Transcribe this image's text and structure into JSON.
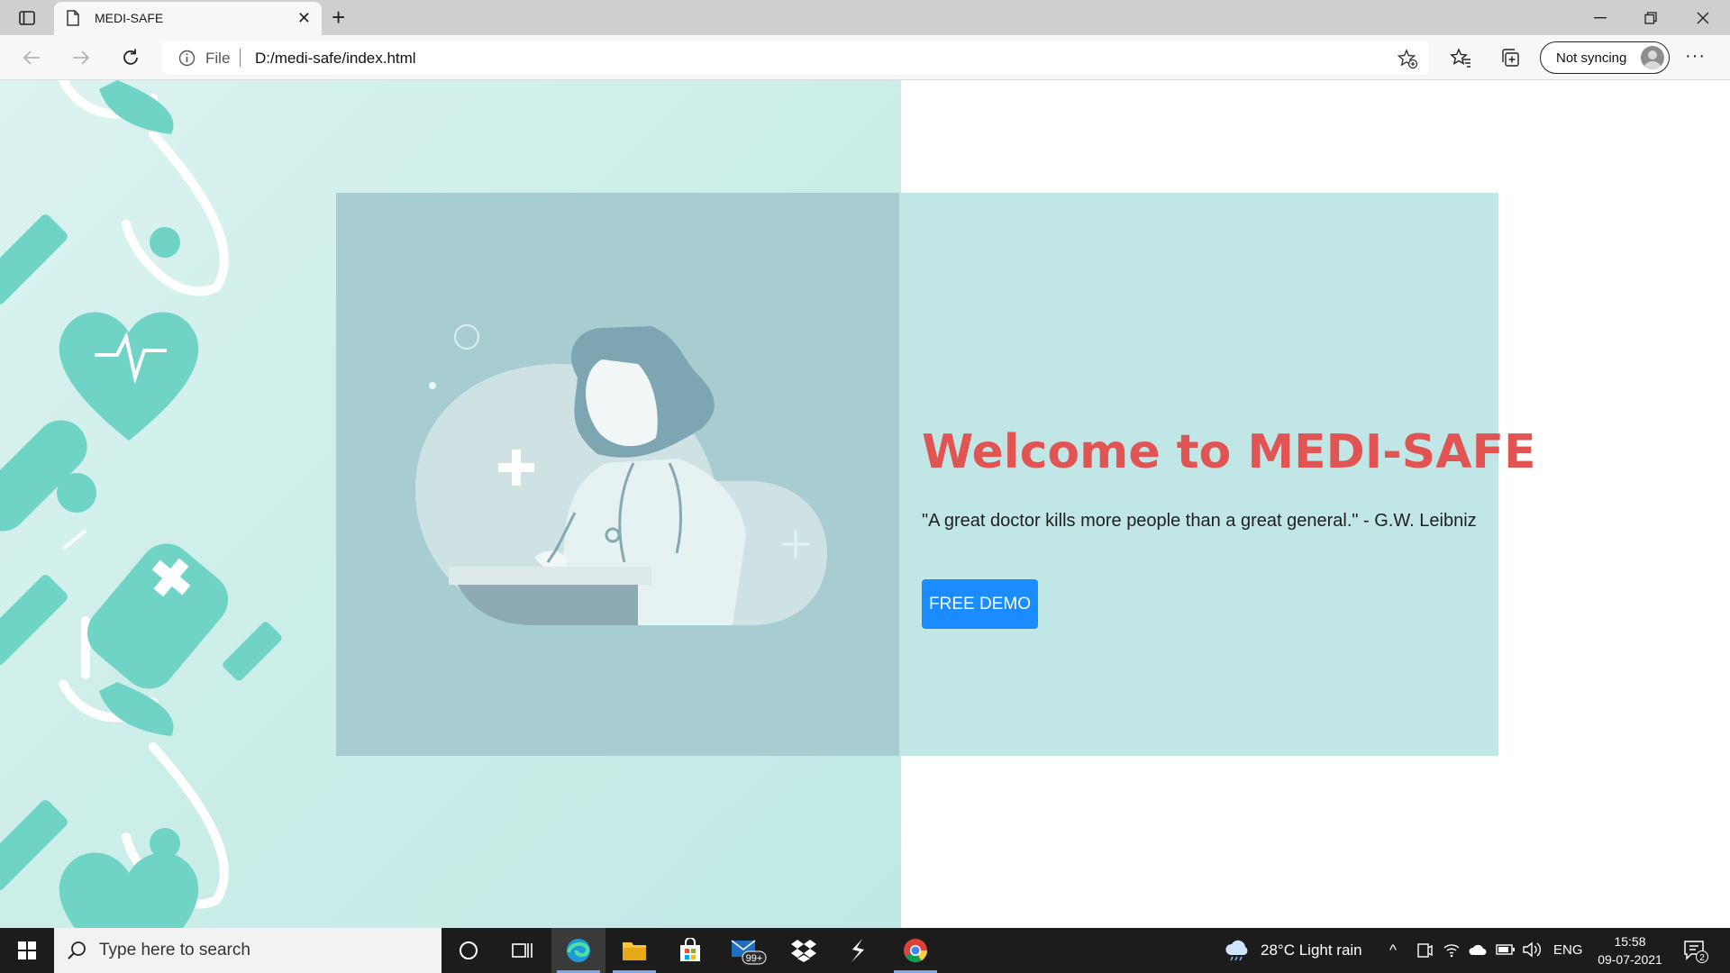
{
  "browser": {
    "tab_title": "MEDI-SAFE",
    "address_scheme": "File",
    "address_url": "D:/medi-safe/index.html",
    "profile_label": "Not syncing"
  },
  "page": {
    "heading": "Welcome to MEDI-SAFE",
    "quote": "\"A great doctor kills more people than a great general.\" - G.W. Leibniz",
    "cta_label": "FREE DEMO",
    "colors": {
      "heading": "#e05454",
      "cta": "#1a8cff",
      "hero_bg": "#c1e6e6",
      "pattern": "#6fd3c6"
    }
  },
  "taskbar": {
    "search_placeholder": "Type here to search",
    "weather": "28°C  Light rain",
    "language": "ENG",
    "time": "15:58",
    "date": "09-07-2021",
    "mail_badge": "99+",
    "notification_count": "2"
  }
}
